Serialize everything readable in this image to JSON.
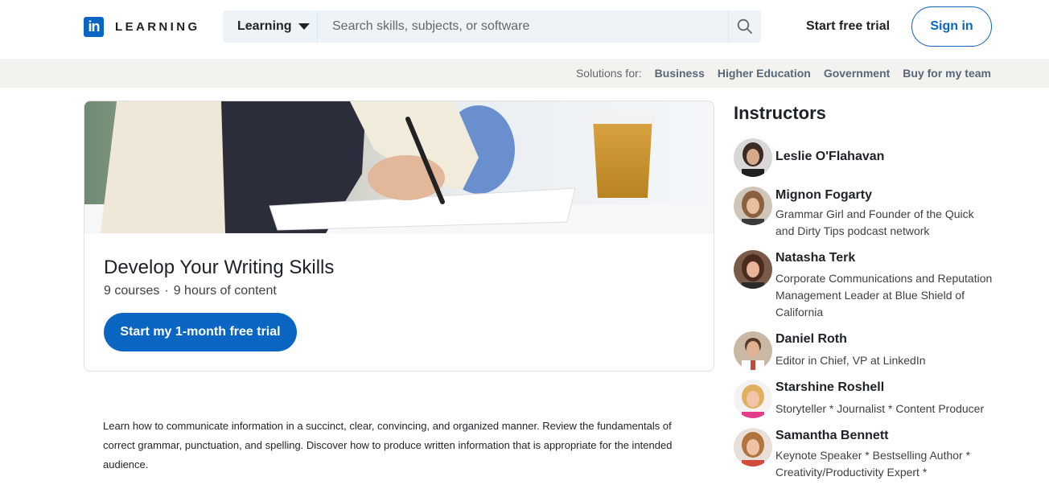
{
  "header": {
    "logo_text": "LEARNING",
    "search_select": "Learning",
    "search_placeholder": "Search skills, subjects, or software",
    "trial_link": "Start free trial",
    "signin": "Sign in"
  },
  "subnav": {
    "label": "Solutions for:",
    "links": [
      "Business",
      "Higher Education",
      "Government",
      "Buy for my team"
    ]
  },
  "course": {
    "title": "Develop Your Writing Skills",
    "courses_count": "9 courses",
    "separator": "·",
    "hours": "9 hours of content",
    "cta": "Start my 1-month free trial",
    "description": "Learn how to communicate information in a succinct, clear, convincing, and organized manner. Review the fundamentals of correct grammar, punctuation, and spelling. Discover how to produce written information that is appropriate for the intended audience."
  },
  "instructors": {
    "title": "Instructors",
    "items": [
      {
        "name": "Leslie O'Flahavan",
        "desc": ""
      },
      {
        "name": "Mignon Fogarty",
        "desc": "Grammar Girl and Founder of the Quick and Dirty Tips podcast network"
      },
      {
        "name": "Natasha Terk",
        "desc": "Corporate Communications and Reputation Management Leader at Blue Shield of California"
      },
      {
        "name": "Daniel Roth",
        "desc": "Editor in Chief, VP at LinkedIn"
      },
      {
        "name": "Starshine Roshell",
        "desc": "Storyteller * Journalist * Content Producer"
      },
      {
        "name": "Samantha Bennett",
        "desc": "Keynote Speaker * Bestselling Author * Creativity/Productivity Expert *"
      }
    ]
  },
  "colors": {
    "brand": "#0a66c2",
    "search_bg": "#eef3f8",
    "subnav_bg": "#f3f2ef"
  },
  "icons": {
    "logo": "linkedin-in-logo",
    "search": "search-icon",
    "dropdown": "caret-down-icon"
  }
}
